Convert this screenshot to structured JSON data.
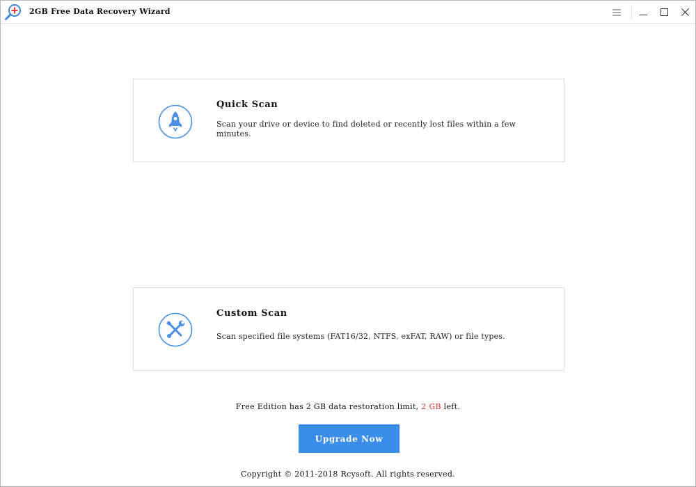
{
  "window": {
    "title": "2GB Free Data Recovery Wizard",
    "app_icon": "magnifier-plus-icon",
    "controls": {
      "menu_icon": "hamburger-menu-icon",
      "minimize_icon": "minimize-icon",
      "maximize_icon": "maximize-icon",
      "close_icon": "close-icon"
    }
  },
  "scan_options": {
    "quick": {
      "icon": "rocket-icon",
      "title": "Quick Scan",
      "description": "Scan your drive or device to find deleted or recently lost files within a few minutes."
    },
    "custom": {
      "icon": "tools-icon",
      "title": "Custom Scan",
      "description": "Scan specified file systems (FAT16/32, NTFS, exFAT, RAW) or file types."
    }
  },
  "footer": {
    "limit_prefix": "Free Edition has 2 GB data restoration limit, ",
    "limit_remaining": "2 GB",
    "limit_suffix": " left.",
    "upgrade_label": "Upgrade Now",
    "copyright": "Copyright © 2011-2018 Rcysoft. All rights reserved."
  },
  "colors": {
    "accent_blue": "#3a8eea",
    "icon_blue": "#4a8fe3",
    "remaining_red": "#d23b3b"
  }
}
